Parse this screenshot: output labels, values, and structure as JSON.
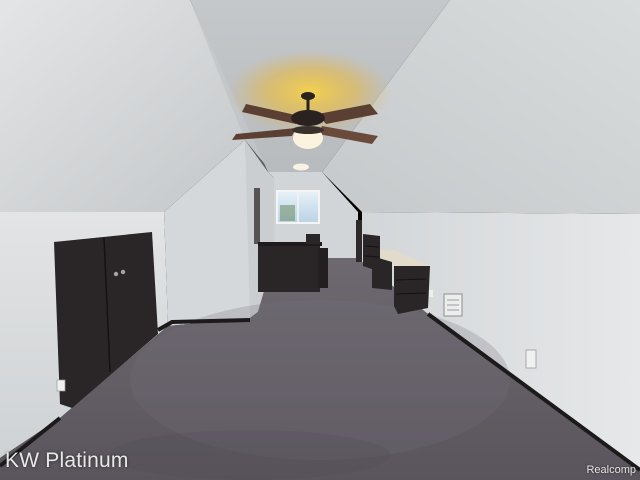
{
  "watermarks": {
    "brand": "KW Platinum",
    "source": "Realcomp"
  },
  "colors": {
    "wall": "#d8dadc",
    "ceiling": "#c9cbcd",
    "carpet": "#5e5961",
    "trim": "#1c1a1b",
    "cabinet": "#2a2526",
    "lamp_glow": "#f2c640"
  }
}
